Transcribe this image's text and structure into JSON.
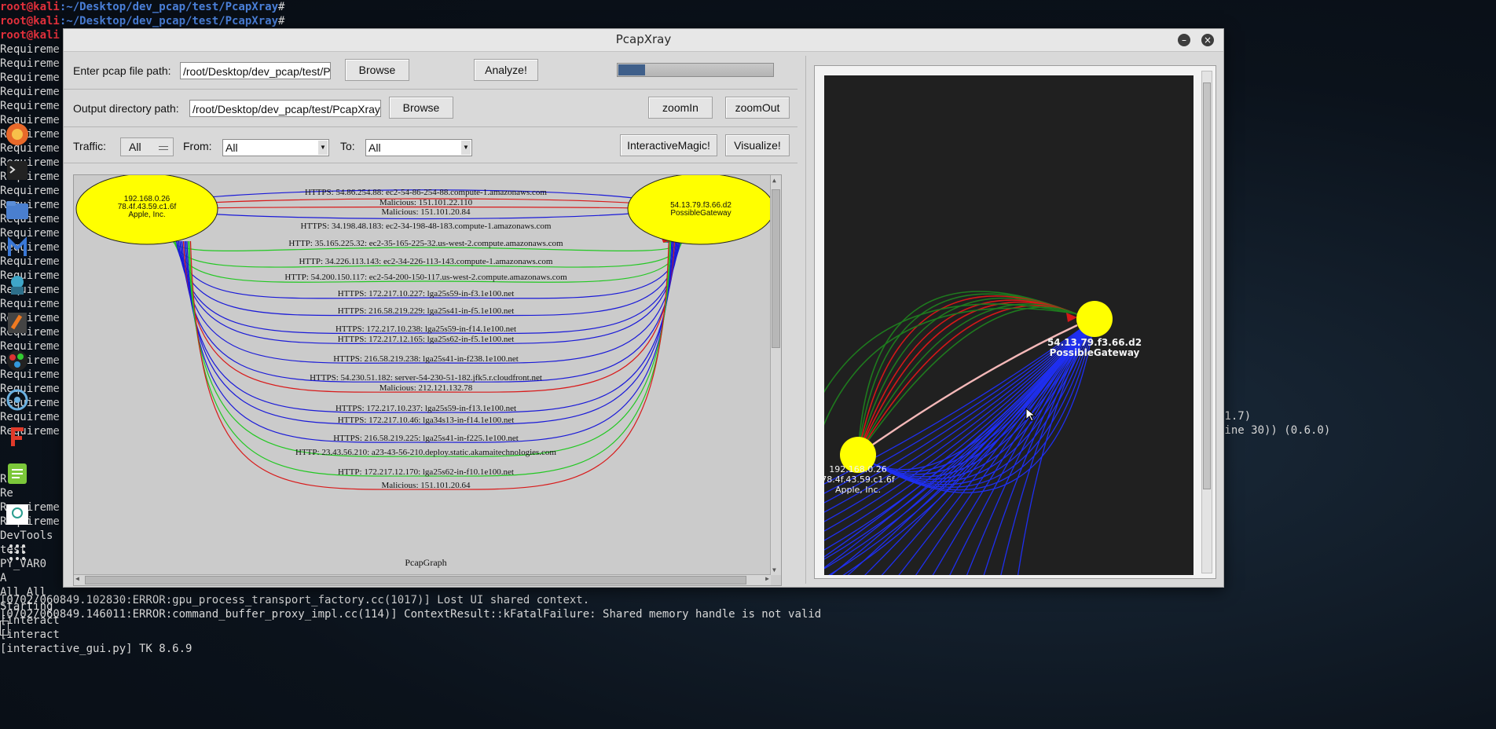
{
  "terminal": {
    "user": "root@kali",
    "path": ":~/Desktop/dev_pcap/test/PcapXray",
    "prompt_char": "#",
    "requirement_prefix": "Requireme",
    "lines_left": [
      "R",
      "Re",
      "Requireme",
      "Requireme",
      "DevTools",
      "test",
      "PY_VAR0",
      "A",
      "All All",
      "Starting",
      "[interact",
      "[interact",
      "[interactive_gui.py] TK 8.6.9"
    ],
    "error1": "[0702/060849.102830:ERROR:gpu_process_transport_factory.cc(1017)] Lost UI shared context.",
    "error2": "[0702/060849.146011:ERROR:command_buffer_proxy_impl.cc(114)] ContextResult::kFatalFailure: Shared memory handle is not valid",
    "right1": ")",
    "right2": ".1.7)",
    "right3": "line 30)) (0.6.0)"
  },
  "window": {
    "title": "PcapXray",
    "minimize": "–",
    "close": "×"
  },
  "row1": {
    "label": "Enter pcap file path:",
    "value": "/root/Desktop/dev_pcap/test/PcapXray/Sample",
    "browse": "Browse",
    "analyze": "Analyze!",
    "progress_fraction": 0.17
  },
  "row2": {
    "label": "Output directory path:",
    "value": "/root/Desktop/dev_pcap/test/PcapXray/Report",
    "browse": "Browse",
    "zoom_in": "zoomIn",
    "zoom_out": "zoomOut"
  },
  "row3": {
    "traffic_label": "Traffic:",
    "traffic_value": "All",
    "from_label": "From:",
    "from_value": "All",
    "to_label": "To:",
    "to_value": "All",
    "interactive": "InteractiveMagic!",
    "visualize": "Visualize!"
  },
  "graph": {
    "source_node": [
      "192.168.0.26",
      "78.4f.43.59.c1.6f",
      "Apple, Inc."
    ],
    "dest_node": [
      "54.13.79.f3.66.d2",
      "PossibleGateway"
    ],
    "caption": "PcapGraph",
    "edges": [
      {
        "label": "HTTPS: 54.86.254.88: ec2-54-86-254-88.compute-1.amazonaws.com",
        "color": "#1a1ad8"
      },
      {
        "label": "Malicious: 151.101.22.110",
        "color": "#d81a1a"
      },
      {
        "label": "Malicious: 151.101.20.84",
        "color": "#d81a1a"
      },
      {
        "label": "HTTPS: 34.198.48.183: ec2-34-198-48-183.compute-1.amazonaws.com",
        "color": "#1a1ad8"
      },
      {
        "label": "HTTP: 35.165.225.32: ec2-35-165-225-32.us-west-2.compute.amazonaws.com",
        "color": "#22c822"
      },
      {
        "label": "HTTP: 34.226.113.143: ec2-34-226-113-143.compute-1.amazonaws.com",
        "color": "#22c822"
      },
      {
        "label": "HTTP: 54.200.150.117: ec2-54-200-150-117.us-west-2.compute.amazonaws.com",
        "color": "#22c822"
      },
      {
        "label": "HTTPS: 172.217.10.227: lga25s59-in-f3.1e100.net",
        "color": "#1a1ad8"
      },
      {
        "label": "HTTPS: 216.58.219.229: lga25s41-in-f5.1e100.net",
        "color": "#1a1ad8"
      },
      {
        "label": "HTTPS: 172.217.10.238: lga25s59-in-f14.1e100.net",
        "color": "#1a1ad8"
      },
      {
        "label": "HTTPS: 172.217.12.165: lga25s62-in-f5.1e100.net",
        "color": "#1a1ad8"
      },
      {
        "label": "HTTPS: 216.58.219.238: lga25s41-in-f238.1e100.net",
        "color": "#1a1ad8"
      },
      {
        "label": "HTTPS: 54.230.51.182: server-54-230-51-182.jfk5.r.cloudfront.net",
        "color": "#1a1ad8"
      },
      {
        "label": "Malicious: 212.121.132.78",
        "color": "#d81a1a"
      },
      {
        "label": "HTTPS: 172.217.10.237: lga25s59-in-f13.1e100.net",
        "color": "#1a1ad8"
      },
      {
        "label": "HTTPS: 172.217.10.46: lga34s13-in-f14.1e100.net",
        "color": "#1a1ad8"
      },
      {
        "label": "HTTPS: 216.58.219.225: lga25s41-in-f225.1e100.net",
        "color": "#1a1ad8"
      },
      {
        "label": "HTTP: 23.43.56.210: a23-43-56-210.deploy.static.akamaitechnologies.com",
        "color": "#22c822"
      },
      {
        "label": "HTTP: 172.217.12.170: lga25s62-in-f10.1e100.net",
        "color": "#22c822"
      },
      {
        "label": "Malicious: 151.101.20.64",
        "color": "#d81a1a"
      }
    ]
  },
  "interactive_graph": {
    "gateway_label": [
      "54.13.79.f3.66.d2",
      "PossibleGateway"
    ],
    "source_label": [
      "192.168.0.26",
      "78.4f.43.59.c1.6f",
      "Apple, Inc."
    ]
  }
}
